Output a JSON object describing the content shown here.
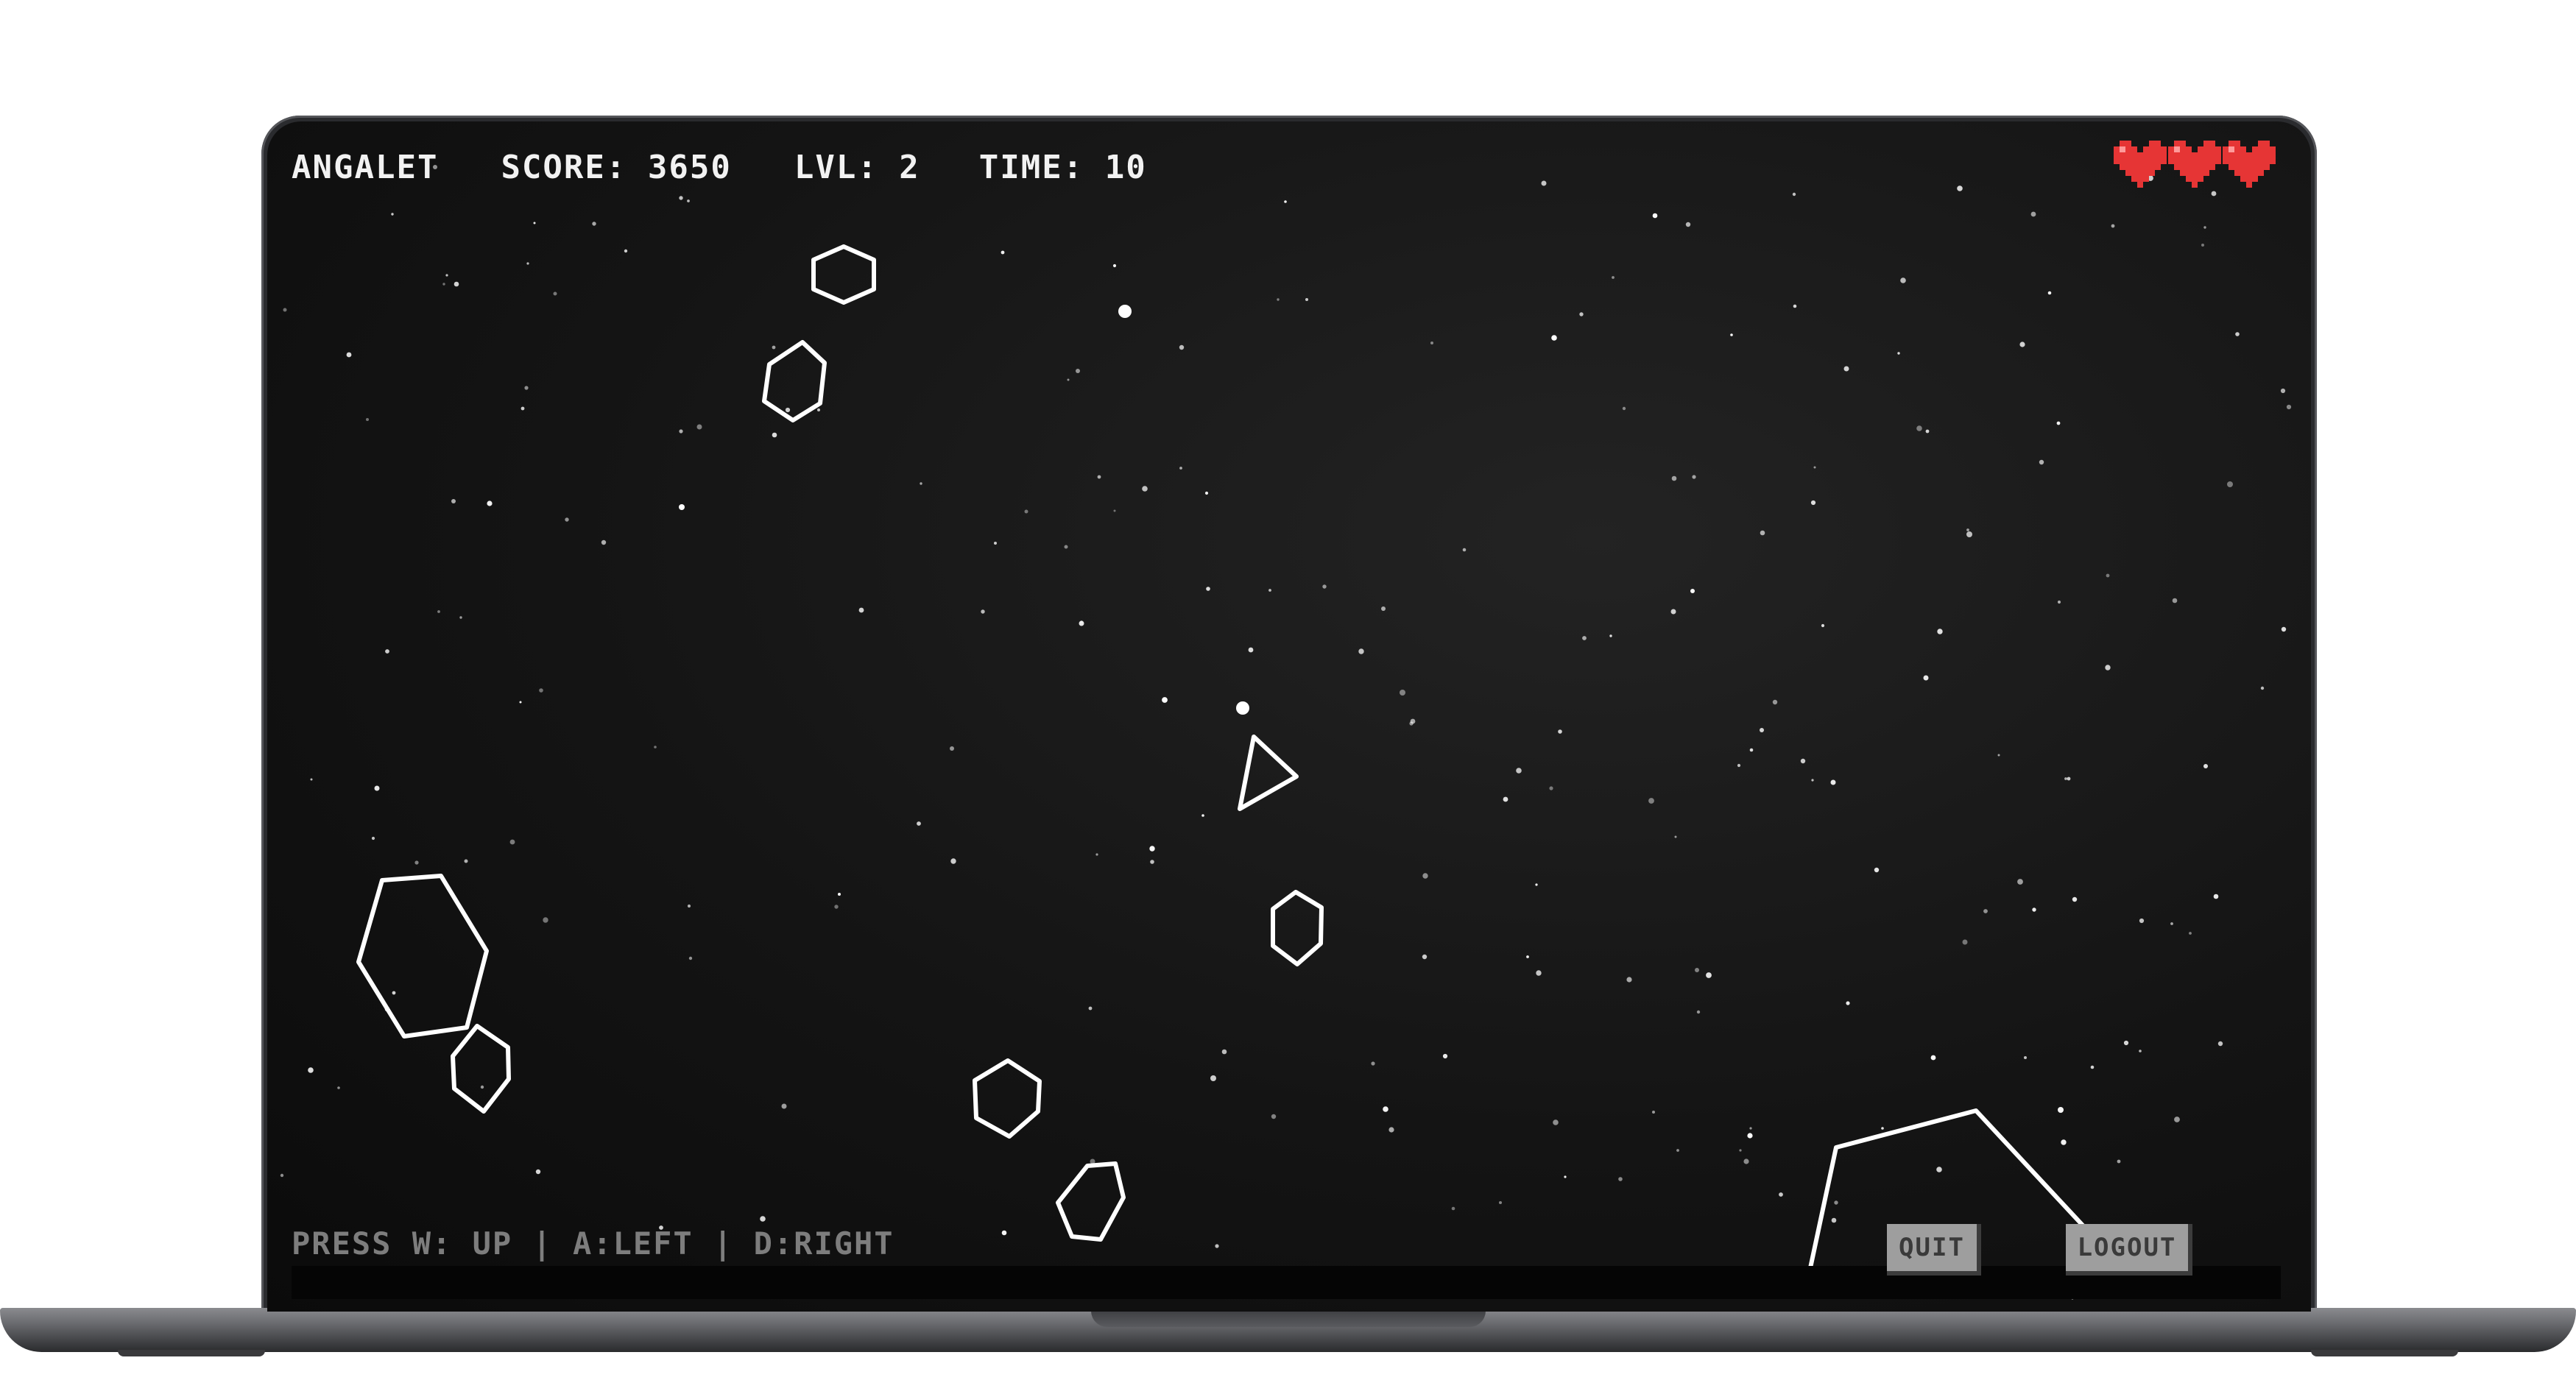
{
  "hud": {
    "player_name": "ANGALET",
    "score_label": "SCORE: 3650",
    "level_label": "LVL: 2",
    "time_label": "TIME: 10"
  },
  "lives": {
    "count": 3,
    "icon": "heart-icon",
    "color": "#e63535"
  },
  "controls_hint": "PRESS W: UP | A:LEFT | D:RIGHT",
  "buttons": {
    "quit": "QUIT",
    "logout": "LOGOUT"
  },
  "colors": {
    "background": "#111111",
    "foreground": "#ffffff",
    "hint": "#7d7d7d",
    "button": "#9e9e9e"
  }
}
